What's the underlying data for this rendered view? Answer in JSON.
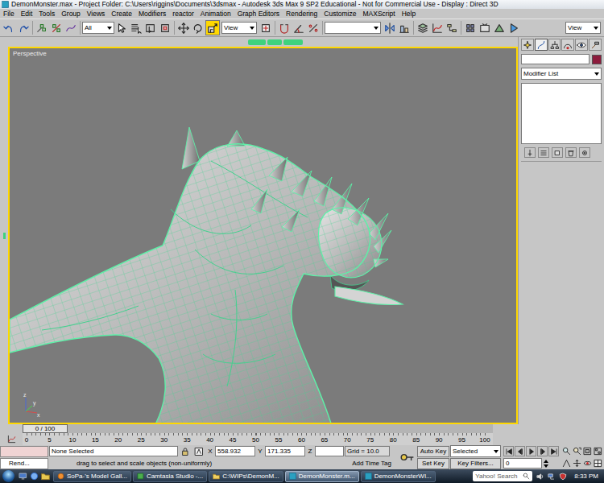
{
  "window": {
    "title": "DemonMonster.max - Project Folder: C:\\Users\\riggins\\Documents\\3dsmax - Autodesk 3ds Max 9 SP2 Educational - Not for Commercial Use - Display : Direct 3D"
  },
  "menu": [
    "File",
    "Edit",
    "Tools",
    "Group",
    "Views",
    "Create",
    "Modifiers",
    "reactor",
    "Animation",
    "Graph Editors",
    "Rendering",
    "Customize",
    "MAXScript",
    "Help"
  ],
  "toolbar": {
    "selection_filter": "All",
    "reference_coord": "View",
    "named_selection": "",
    "render_view": "View",
    "transform_tools": [
      {
        "selected": false
      },
      {
        "selected": false
      },
      {
        "selected": true
      }
    ]
  },
  "viewport": {
    "label": "Perspective",
    "axes": [
      "z",
      "y",
      "x"
    ]
  },
  "command_panel": {
    "tabs": [
      {
        "selected": false
      },
      {
        "selected": true
      },
      {
        "selected": false
      },
      {
        "selected": false
      },
      {
        "selected": false
      },
      {
        "selected": false
      }
    ],
    "object_name": "",
    "color": "#8c1b3c",
    "modifier_list": "Modifier List"
  },
  "time_slider": {
    "label": "0 / 100",
    "level": 0
  },
  "track_bar": {
    "ticks": [
      "0",
      "5",
      "10",
      "15",
      "20",
      "25",
      "30",
      "35",
      "40",
      "45",
      "50",
      "55",
      "60",
      "65",
      "70",
      "75",
      "80",
      "85",
      "90",
      "95",
      "100"
    ]
  },
  "status": {
    "listener": "Rend...",
    "selection": "None Selected",
    "coords": [
      {
        "axis": "X",
        "value": "558.932"
      },
      {
        "axis": "Y",
        "value": "171.335"
      },
      {
        "axis": "Z",
        "value": ""
      }
    ],
    "grid": "Grid = 10.0",
    "prompt": "drag to select and scale objects (non-uniformly)",
    "time_tag": "Add Time Tag"
  },
  "animation": {
    "auto_key": "Auto Key",
    "auto_key_on": false,
    "set_key": "Set Key",
    "key_mode": "Selected",
    "key_filters": "Key Filters...",
    "frame": "0"
  },
  "taskbar": {
    "tasks": [
      {
        "label": "SoPa-'s Model Gall...",
        "selected": false
      },
      {
        "label": "Camtasia Studio -...",
        "selected": false
      },
      {
        "label": "C:\\WIPs\\DemonM...",
        "selected": false
      },
      {
        "label": "DemonMonster.m...",
        "selected": true
      },
      {
        "label": "DemonMonsterWI...",
        "selected": false
      }
    ],
    "search": {
      "placeholder": "Yahoo! Search"
    },
    "clock": "8:33 PM"
  }
}
